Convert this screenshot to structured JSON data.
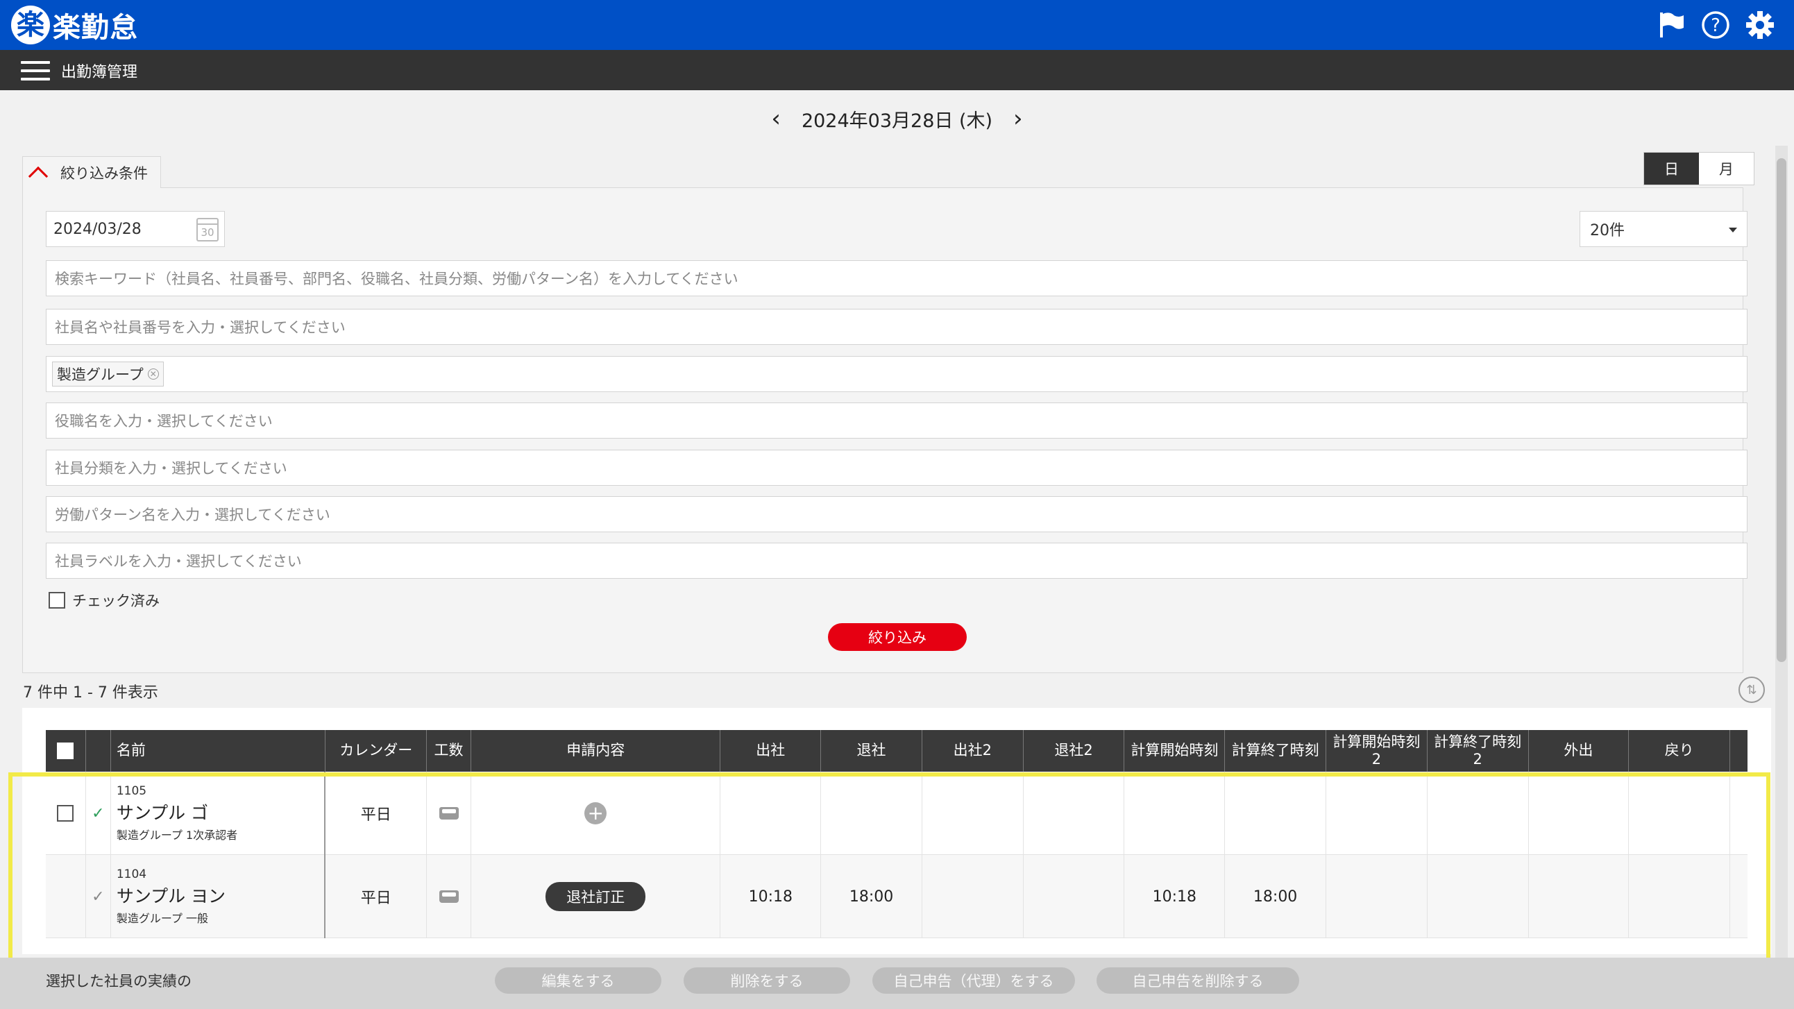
{
  "app": {
    "logo_mark": "楽",
    "logo_text": "楽勤怠"
  },
  "header": {
    "page_title": "出勤簿管理",
    "icons": [
      "flag-icon",
      "help-icon",
      "gear-icon"
    ]
  },
  "date_nav": {
    "date_label": "2024年03月28日 (木)",
    "prev": "‹",
    "next": "›"
  },
  "filter": {
    "tab_label": "絞り込み条件",
    "date_value": "2024/03/28",
    "calendar_icon_text": "30",
    "view_day": "日",
    "view_month": "月",
    "per_page": "20件",
    "keyword_placeholder": "検索キーワード（社員名、社員番号、部門名、役職名、社員分類、労働パターン名）を入力してください",
    "employee_placeholder": "社員名や社員番号を入力・選択してください",
    "department_chip": "製造グループ",
    "position_placeholder": "役職名を入力・選択してください",
    "category_placeholder": "社員分類を入力・選択してください",
    "pattern_placeholder": "労働パターン名を入力・選択してください",
    "label_placeholder": "社員ラベルを入力・選択してください",
    "checked_label": "チェック済み",
    "submit_label": "絞り込み"
  },
  "results": {
    "count_text": "7 件中 1 - 7 件表示"
  },
  "table": {
    "headers": {
      "name": "名前",
      "calendar": "カレンダー",
      "effort": "工数",
      "request": "申請内容",
      "in": "出社",
      "out": "退社",
      "in2": "出社2",
      "out2": "退社2",
      "calc_start": "計算開始時刻",
      "calc_end": "計算終了時刻",
      "calc_start2_a": "計算開始時刻",
      "calc_start2_b": "2",
      "calc_end2_a": "計算終了時刻",
      "calc_end2_b": "2",
      "go_out": "外出",
      "return": "戻り"
    },
    "rows": [
      {
        "emp_no": "1105",
        "name": "サンプル ゴ",
        "group": "製造グループ 1次承認者",
        "calendar": "平日",
        "request": "",
        "in": "",
        "out": "",
        "in2": "",
        "out2": "",
        "calc_start": "",
        "calc_end": "",
        "calc_start2": "",
        "calc_end2": "",
        "go_out": "",
        "return": ""
      },
      {
        "emp_no": "1104",
        "name": "サンプル ヨン",
        "group": "製造グループ 一般",
        "calendar": "平日",
        "request": "退社訂正",
        "in": "10:18",
        "out": "18:00",
        "in2": "",
        "out2": "",
        "calc_start": "10:18",
        "calc_end": "18:00",
        "calc_start2": "",
        "calc_end2": "",
        "go_out": "",
        "return": ""
      }
    ]
  },
  "actions": {
    "selected_label": "選択した社員の実績の",
    "edit": "編集をする",
    "delete": "削除をする",
    "self_report": "自己申告（代理）をする",
    "delete_self_report": "自己申告を削除する"
  },
  "colors": {
    "brand": "#0050c6",
    "accent": "#e60012",
    "highlight": "#f2ea48"
  }
}
